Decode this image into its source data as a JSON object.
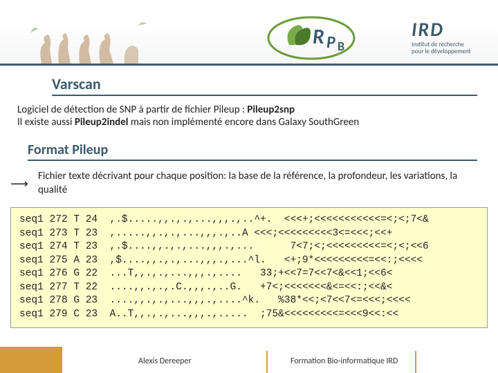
{
  "header": {
    "ird_label": "IRD",
    "ird_sub1": "Institut de recherche",
    "ird_sub2": "pour le développement",
    "rpb_r": "R",
    "rpb_p": "P",
    "rpb_b": "B"
  },
  "title": "Varscan",
  "desc": {
    "pre": "Logiciel de détection de SNP à partir de fichier Pileup : ",
    "tool1": "Pileup2snp",
    "line2a": "Il existe aussi ",
    "tool2": "Pileup2indel",
    "line2b": " mais non implémenté encore dans Galaxy SouthGreen"
  },
  "subtitle": "Format Pileup",
  "desc2": "Fichier texte décrivant pour chaque position: la base de la référence, la profondeur, les variations, la qualité",
  "code": {
    "l1": "seq1 272 T 24  ,.$.....,,.,.,...,,,.,..^+.  <<<+;<<<<<<<<<<<=<;<;7<&",
    "l2": "seq1 273 T 23  ,.....,,.,.,...,,,.,..A <<<;<<<<<<<<<3<=<<<;<<+",
    "l3": "seq1 274 T 23  ,.$....,,.,.,...,,,.,...      7<7;<;<<<<<<<<<=<;<;<<6",
    "l4": "seq1 275 A 23  ,$....,,.,.,...,,,.,...^l.   <+;9*<<<<<<<<<=<<:;<<<<",
    "l5": "seq1 276 G 22  ...T,,.,.,...,,,.,....   33;+<<7=7<<7<&<<1;<<6<",
    "l6": "seq1 277 T 22  ....,,.,.,.C.,,,.,..G.   +7<;<<<<<<<&<=<<:;<<&<",
    "l7": "seq1 278 G 23  ....,,.,.,...,,,.,....^k.   %38*<<;<7<<7<=<<<;<<<<",
    "l8": "seq1 279 C 23  A..T,,.,.,...,,,.,.....  ;75&<<<<<<<<<=<<<9<<:<<"
  },
  "footer": {
    "author": "Alexis Dereeper",
    "course": "Formation Bio-informatique IRD"
  }
}
